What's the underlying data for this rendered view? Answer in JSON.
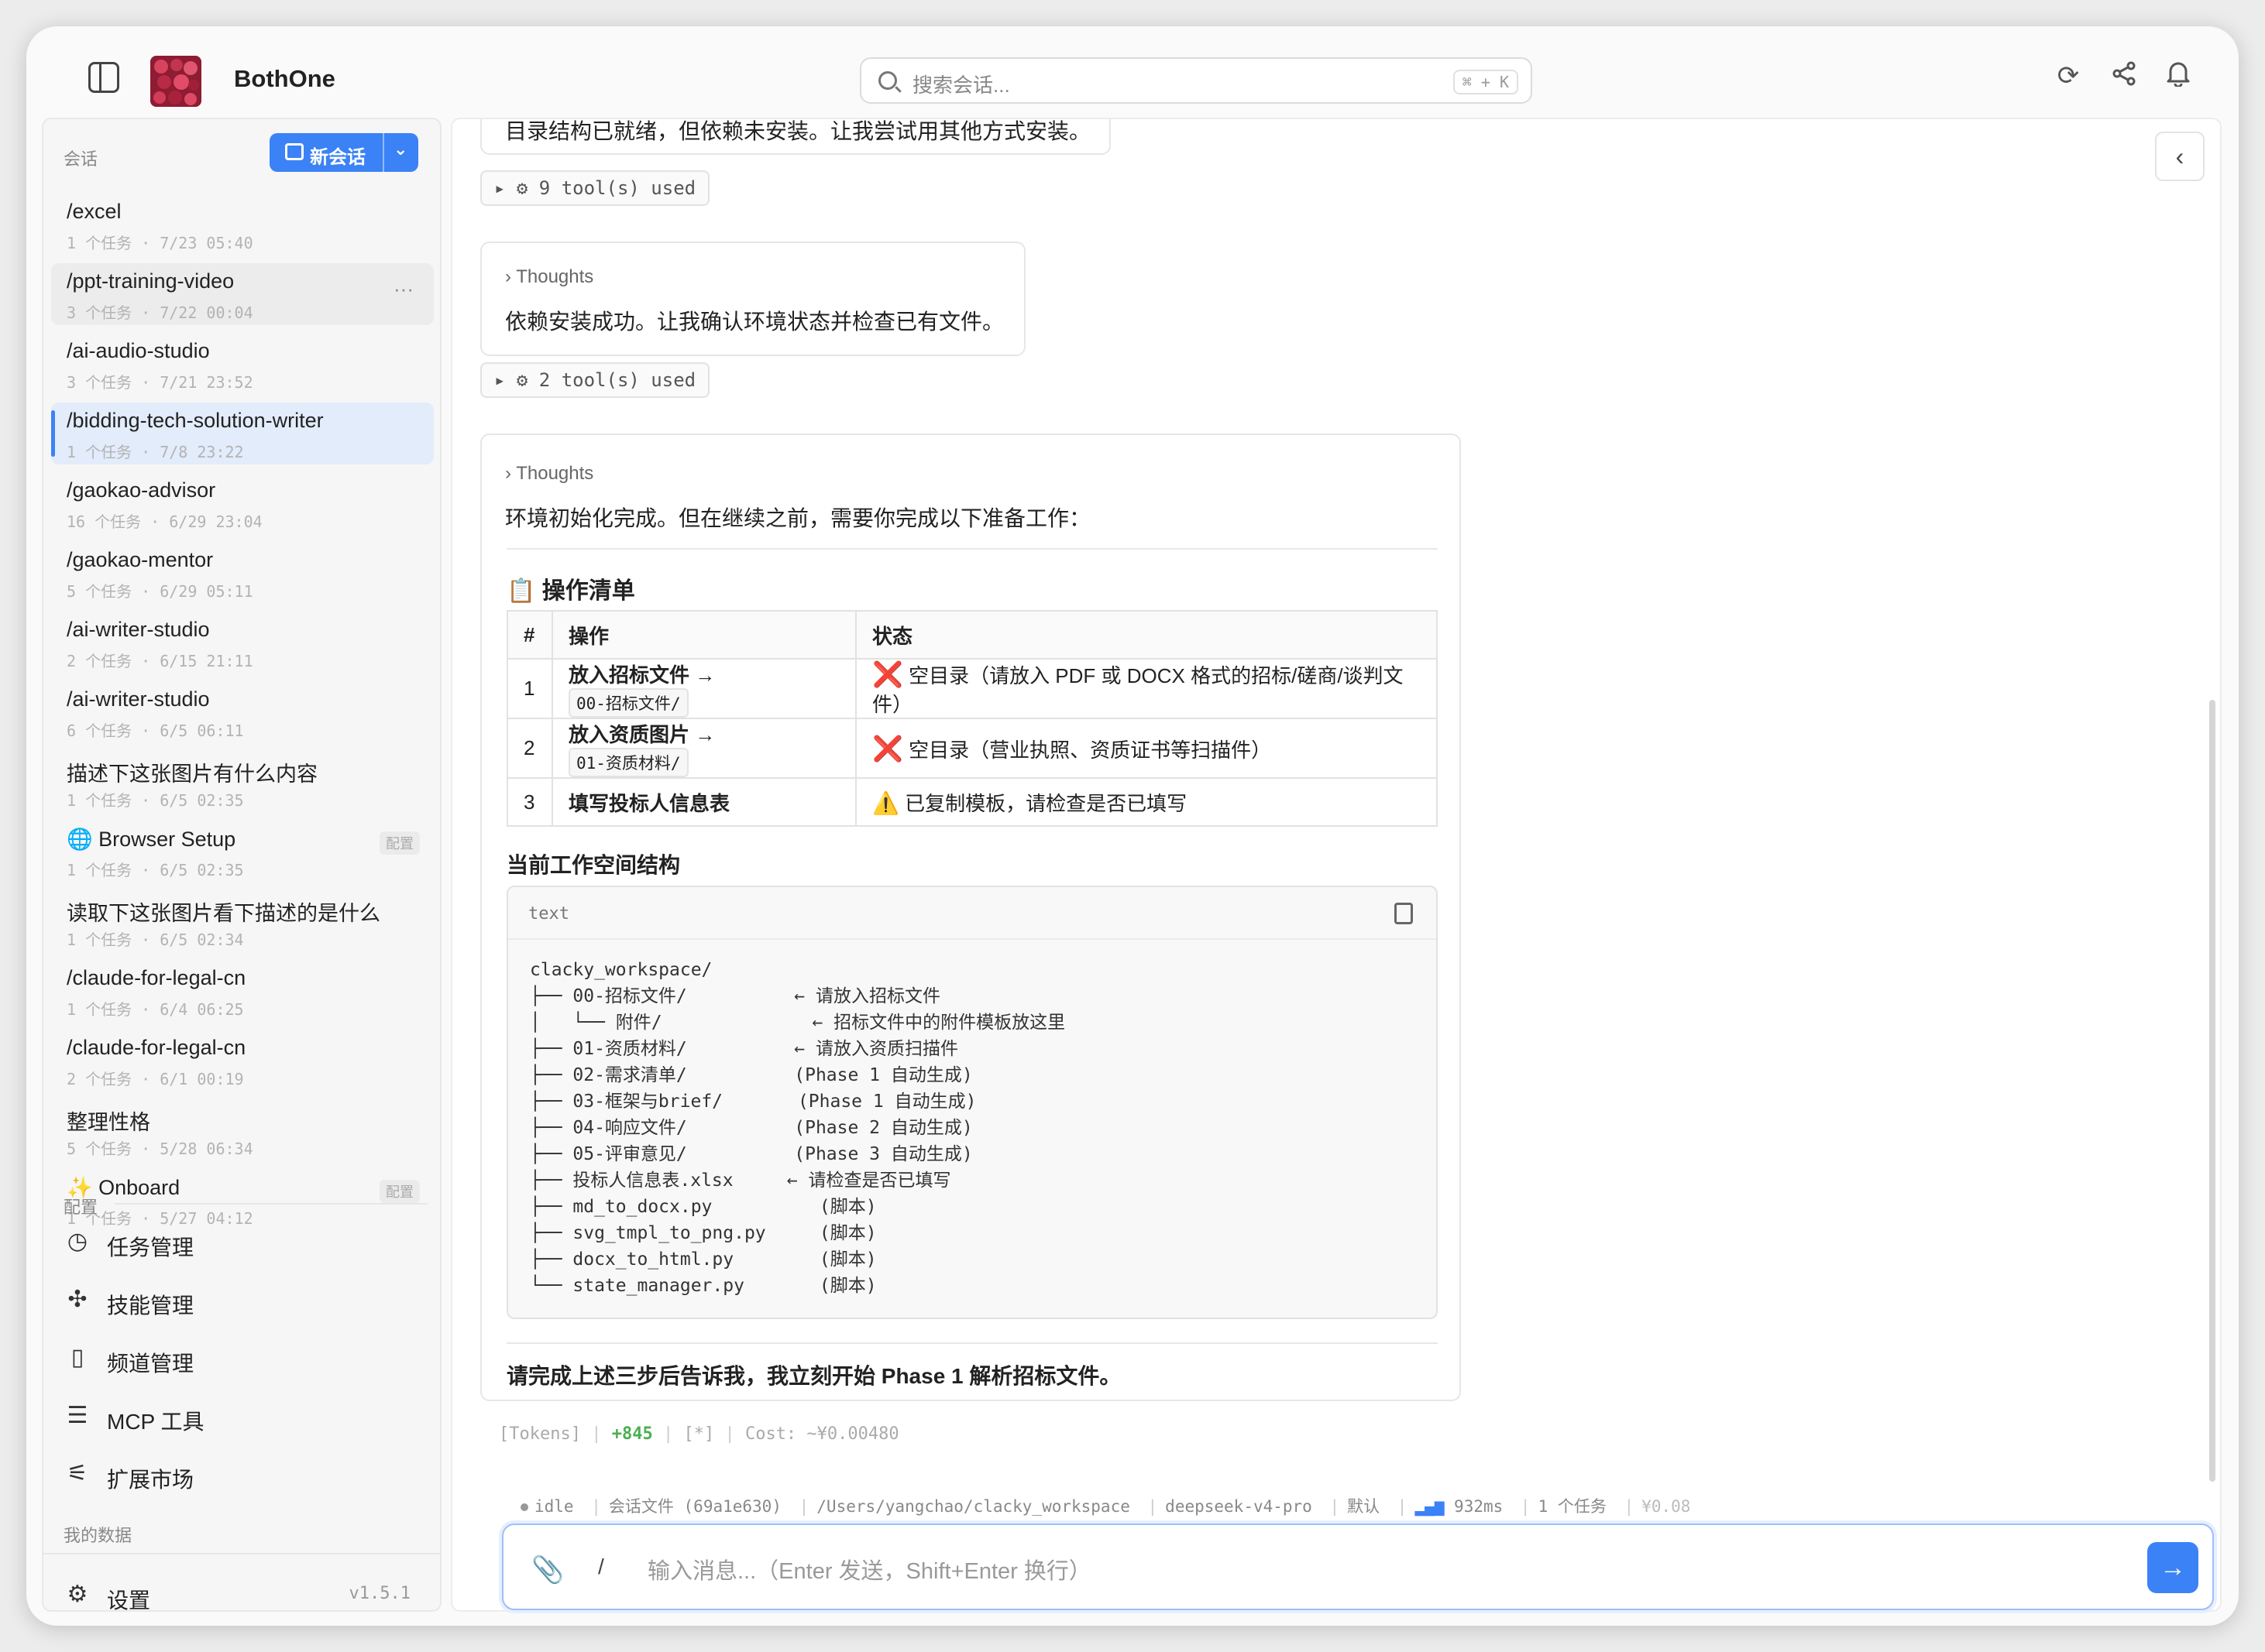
{
  "app": {
    "title": "BothOne"
  },
  "search": {
    "placeholder": "搜索会话...",
    "shortcut": "⌘ + K"
  },
  "sidebar": {
    "sessions_label": "会话",
    "new_session_label": "新会话",
    "sessions": [
      {
        "title": "/excel",
        "meta": "1 个任务 · 7/23 05:40"
      },
      {
        "title": "/ppt-training-video",
        "meta": "3 个任务 · 7/22 00:04"
      },
      {
        "title": "/ai-audio-studio",
        "meta": "3 个任务 · 7/21 23:52"
      },
      {
        "title": "/bidding-tech-solution-writer",
        "meta": "1 个任务 · 7/8 23:22"
      },
      {
        "title": "/gaokao-advisor",
        "meta": "16 个任务 · 6/29 23:04"
      },
      {
        "title": "/gaokao-mentor",
        "meta": "5 个任务 · 6/29 05:11"
      },
      {
        "title": "/ai-writer-studio",
        "meta": "2 个任务 · 6/15 21:11"
      },
      {
        "title": "/ai-writer-studio",
        "meta": "6 个任务 · 6/5 06:11"
      },
      {
        "title": "描述下这张图片有什么内容",
        "meta": "1 个任务 · 6/5 02:35"
      },
      {
        "title": "🌐 Browser Setup",
        "meta": "1 个任务 · 6/5 02:35",
        "badge": "配置"
      },
      {
        "title": "读取下这张图片看下描述的是什么",
        "meta": "1 个任务 · 6/5 02:34"
      },
      {
        "title": "/claude-for-legal-cn",
        "meta": "1 个任务 · 6/4 06:25"
      },
      {
        "title": "/claude-for-legal-cn",
        "meta": "2 个任务 · 6/1 00:19"
      },
      {
        "title": "整理性格",
        "meta": "5 个任务 · 5/28 06:34"
      },
      {
        "title": "✨ Onboard",
        "meta": "1 个任务 · 5/27 04:12",
        "badge": "配置"
      }
    ],
    "config_label": "配置",
    "nav": [
      {
        "label": "任务管理",
        "icon": "clock-icon"
      },
      {
        "label": "技能管理",
        "icon": "puzzle-icon"
      },
      {
        "label": "频道管理",
        "icon": "phone-icon"
      },
      {
        "label": "MCP 工具",
        "icon": "server-icon"
      },
      {
        "label": "扩展市场",
        "icon": "sliders-icon"
      }
    ],
    "my_data_label": "我的数据",
    "settings_label": "设置",
    "version": "v1.5.1"
  },
  "chat": {
    "prev_text": "目录结构已就绪，但依赖未安装。让我尝试用其他方式安装。",
    "tools1": "▸ ⚙ 9 tool(s) used",
    "thoughts1_label": "› Thoughts",
    "thoughts1_text": "依赖安装成功。让我确认环境状态并检查已有文件。",
    "tools2": "▸ ⚙ 2 tool(s) used",
    "thoughts2_label": "› Thoughts",
    "intro": "环境初始化完成。但在继续之前，需要你完成以下准备工作：",
    "checklist_title": "📋 操作清单",
    "table": {
      "headers": [
        "#",
        "操作",
        "状态"
      ],
      "rows": [
        {
          "num": "1",
          "op": "放入招标文件 →",
          "chip": "00-招标文件/",
          "mark": "❌",
          "status": "空目录（请放入 PDF 或 DOCX 格式的招标/磋商/谈判文件）"
        },
        {
          "num": "2",
          "op": "放入资质图片 →",
          "chip": "01-资质材料/",
          "mark": "❌",
          "status": "空目录（营业执照、资质证书等扫描件）"
        },
        {
          "num": "3",
          "op": "填写投标人信息表",
          "chip": "",
          "mark": "⚠️",
          "status": "已复制模板，请检查是否已填写"
        }
      ]
    },
    "workspace_title": "当前工作空间结构",
    "code_lang": "text",
    "code": "clacky_workspace/\n├── 00-招标文件/          ← 请放入招标文件\n│   └── 附件/              ← 招标文件中的附件模板放这里\n├── 01-资质材料/          ← 请放入资质扫描件\n├── 02-需求清单/          (Phase 1 自动生成)\n├── 03-框架与brief/       (Phase 1 自动生成)\n├── 04-响应文件/          (Phase 2 自动生成)\n├── 05-评审意见/          (Phase 3 自动生成)\n├── 投标人信息表.xlsx     ← 请检查是否已填写\n├── md_to_docx.py          (脚本)\n├── svg_tmpl_to_png.py     (脚本)\n├── docx_to_html.py        (脚本)\n└── state_manager.py       (脚本)",
    "closing": "请完成上述三步后告诉我，我立刻开始 Phase 1 解析招标文件。",
    "tokens_prefix": "[Tokens]",
    "tokens_delta": "+845",
    "tokens_mid": "[*]",
    "tokens_cost": "Cost: ~¥0.00480"
  },
  "status": {
    "state": "idle",
    "session_file": "会话文件 (69a1e630)",
    "path": "/Users/yangchao/clacky_workspace",
    "model": "deepseek-v4-pro",
    "mode": "默认",
    "latency": "932ms",
    "tasks": "1 个任务",
    "cost": "¥0.08"
  },
  "composer": {
    "placeholder": "输入消息...（Enter 发送，Shift+Enter 换行）",
    "slash": "/"
  },
  "colors": {
    "accent": "#3b82f6",
    "error": "#e53935",
    "warning": "#f5b400",
    "plus": "#4caf50"
  }
}
